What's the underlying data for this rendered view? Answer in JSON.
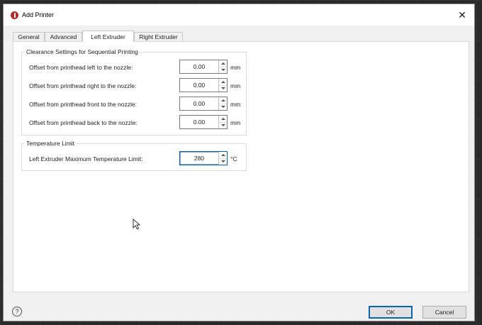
{
  "window": {
    "title": "Add Printer",
    "close_glyph": "✕"
  },
  "tabs": [
    {
      "label": "General"
    },
    {
      "label": "Advanced"
    },
    {
      "label": "Left Extruder"
    },
    {
      "label": "Right Extruder"
    }
  ],
  "active_tab": "Left Extruder",
  "clearance": {
    "title": "Clearance Settings for Sequential Printing",
    "rows": [
      {
        "label": "Offset from printhead left to the nozzle:",
        "value": "0.00",
        "unit": "mm"
      },
      {
        "label": "Offset from printhead right to the nozzle:",
        "value": "0.00",
        "unit": "mm"
      },
      {
        "label": "Offset from printhead front to the nozzle:",
        "value": "0.00",
        "unit": "mm"
      },
      {
        "label": "Offset from printhead back to the nozzle:",
        "value": "0.00",
        "unit": "mm"
      }
    ]
  },
  "temperature": {
    "title": "Temperature Limit",
    "label": "Left Extruder Maximum Temperature Limit:",
    "value": "280",
    "unit": "°C"
  },
  "footer": {
    "help_glyph": "?",
    "ok_label": "OK",
    "cancel_label": "Cancel"
  },
  "colors": {
    "accent": "#0a64b4",
    "app_icon": "#b22a2a"
  },
  "icons": {
    "app": "app-logo-icon",
    "close": "close-icon",
    "help": "help-icon",
    "cursor": "mouse-pointer-icon"
  }
}
